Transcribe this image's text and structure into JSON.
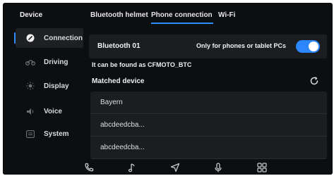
{
  "sidebar": {
    "title": "Device",
    "items": [
      {
        "label": "Connection",
        "icon": "link-icon",
        "active": true
      },
      {
        "label": "Driving",
        "icon": "motorcycle-icon",
        "active": false
      },
      {
        "label": "Display",
        "icon": "brightness-icon",
        "active": false
      },
      {
        "label": "Voice",
        "icon": "speaker-icon",
        "active": false
      },
      {
        "label": "System",
        "icon": "system-icon",
        "active": false
      }
    ]
  },
  "tabs": [
    {
      "label": "Bluetooth helmet",
      "active": false
    },
    {
      "label": "Phone connection",
      "active": true
    },
    {
      "label": "Wi-Fi",
      "active": false
    }
  ],
  "bluetooth": {
    "name": "Bluetooth 01",
    "note": "Only for phones or tablet PCs",
    "enabled": true
  },
  "found_as": "It can be found as CFMOTO_BTC",
  "matched_devices": {
    "title": "Matched device",
    "items": [
      "Bayern",
      "abcdeedcba...",
      "abcdeedcba..."
    ]
  },
  "bottom_bar": {
    "icons": [
      "phone-icon",
      "music-icon",
      "navigation-icon",
      "microphone-icon",
      "apps-grid-icon"
    ]
  },
  "colors": {
    "accent": "#2d8cff",
    "background": "#0d0e10",
    "panel": "#1b1d21"
  }
}
